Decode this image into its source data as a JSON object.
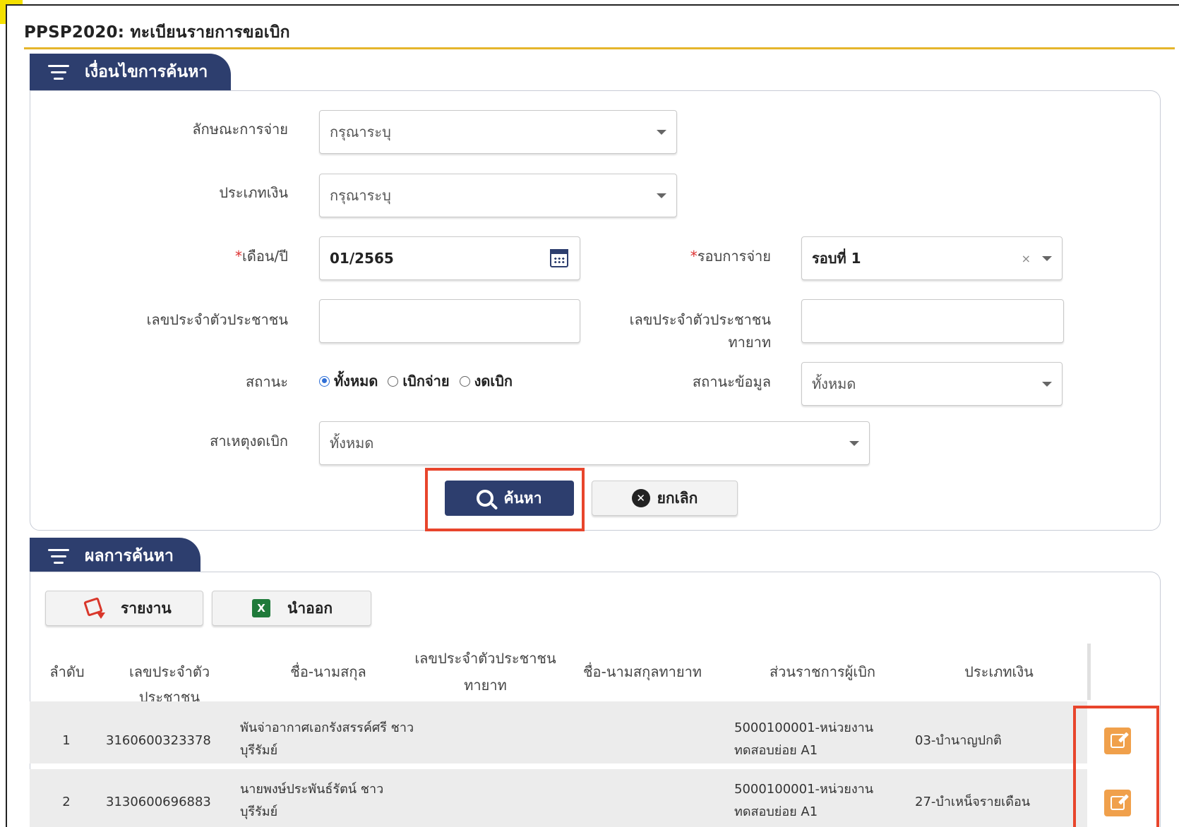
{
  "page": {
    "title": "PPSP2020: ทะเบียนรายการขอเบิก"
  },
  "search_section": {
    "tab_label": "เงื่อนไขการค้นหา",
    "payment_nature": {
      "label": "ลักษณะการจ่าย",
      "value": "กรุณาระบุ"
    },
    "money_type": {
      "label": "ประเภทเงิน",
      "value": "กรุณาระบุ"
    },
    "month_year": {
      "required_mark": "*",
      "label": "เดือน/ปี",
      "value": "01/2565"
    },
    "payment_round": {
      "required_mark": "*",
      "label": "รอบการจ่าย",
      "value": "รอบที่ 1",
      "clear": "×"
    },
    "citizen_id": {
      "label": "เลขประจำตัวประชาชน",
      "value": ""
    },
    "heir_citizen_id": {
      "label": "เลขประจำตัวประชาชนทายาท",
      "value": ""
    },
    "status": {
      "label": "สถานะ",
      "options": [
        "ทั้งหมด",
        "เบิกจ่าย",
        "งดเบิก"
      ],
      "selected_index": 0
    },
    "data_status": {
      "label": "สถานะข้อมูล",
      "value": "ทั้งหมด"
    },
    "stop_reason": {
      "label": "สาเหตุงดเบิก",
      "value": "ทั้งหมด"
    },
    "search_button": "ค้นหา",
    "cancel_button": "ยกเลิก"
  },
  "results_section": {
    "tab_label": "ผลการค้นหา",
    "report_button": "รายงาน",
    "export_button": "นำออก",
    "columns": {
      "seq": "ลำดับ",
      "citizen_id": "เลขประจำตัวประชาชน",
      "name": "ชื่อ-นามสกุล",
      "heir_id_1": "เลขประจำตัวประชาชน",
      "heir_id_2": "ทายาท",
      "heir_name": "ชื่อ-นามสกุลทายาท",
      "agency": "ส่วนราชการผู้เบิก",
      "money_type": "ประเภทเงิน"
    },
    "rows": [
      {
        "seq": "1",
        "citizen_id": "3160600323378",
        "name_1": "พันจ่าอากาศเอกรังสรรค์ศรี ชาว",
        "name_2": "บุรีรัมย์",
        "agency_1": "5000100001-หน่วยงาน",
        "agency_2": "ทดสอบย่อย A1",
        "money_type": "03-บำนาญปกติ"
      },
      {
        "seq": "2",
        "citizen_id": "3130600696883",
        "name_1": "นายพงษ์ประพันธ์รัตน์ ชาว",
        "name_2": "บุรีรัมย์",
        "agency_1": "5000100001-หน่วยงาน",
        "agency_2": "ทดสอบย่อย A1",
        "money_type": "27-บำเหน็จรายเดือน"
      }
    ]
  },
  "colors": {
    "navy": "#2d3e6e",
    "gold_rule": "#e5b52b",
    "highlight_red": "#e8452c",
    "edit_orange": "#f0a04b"
  }
}
